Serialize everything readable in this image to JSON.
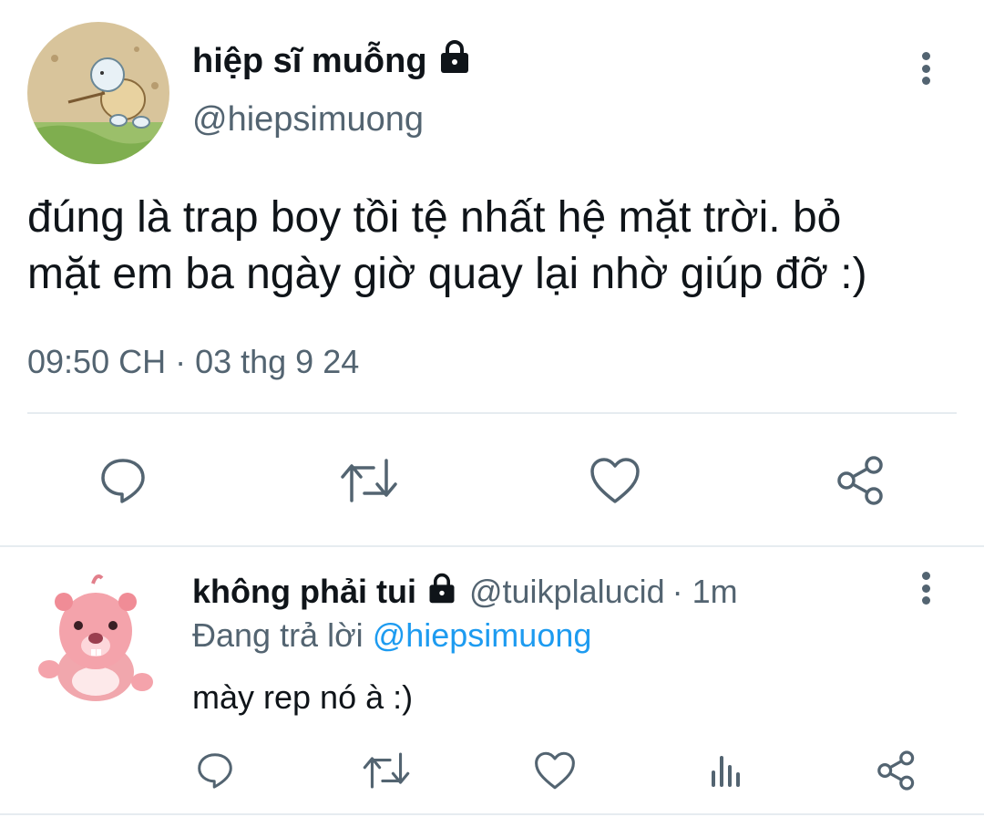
{
  "tweet": {
    "author_name": "hiệp sĩ muỗng",
    "author_handle": "@hiepsimuong",
    "text_line1": "đúng là trap boy tồi tệ nhất hệ mặt trời. bỏ",
    "text_line2": "mặt em ba ngày giờ quay lại nhờ giúp đỡ :)",
    "timestamp": "09:50 CH · 03 thg 9 24",
    "actions": [
      "reply-icon",
      "retweet-icon",
      "like-icon",
      "share-icon"
    ]
  },
  "reply": {
    "author_name": "không phải tui",
    "author_handle": "@tuikplalucid",
    "time": "· 1m",
    "replying_prefix": "Đang trả lời",
    "replying_to": "@hiepsimuong",
    "text": "mày rep nó à :)",
    "actions": [
      "reply-icon",
      "retweet-icon",
      "like-icon",
      "analytics-icon",
      "share-icon"
    ]
  },
  "colors": {
    "primary_text": "#0f1419",
    "secondary_text": "#536471",
    "accent": "#1d9bf0",
    "divider": "#e6ecf0",
    "icon": "#536471"
  }
}
